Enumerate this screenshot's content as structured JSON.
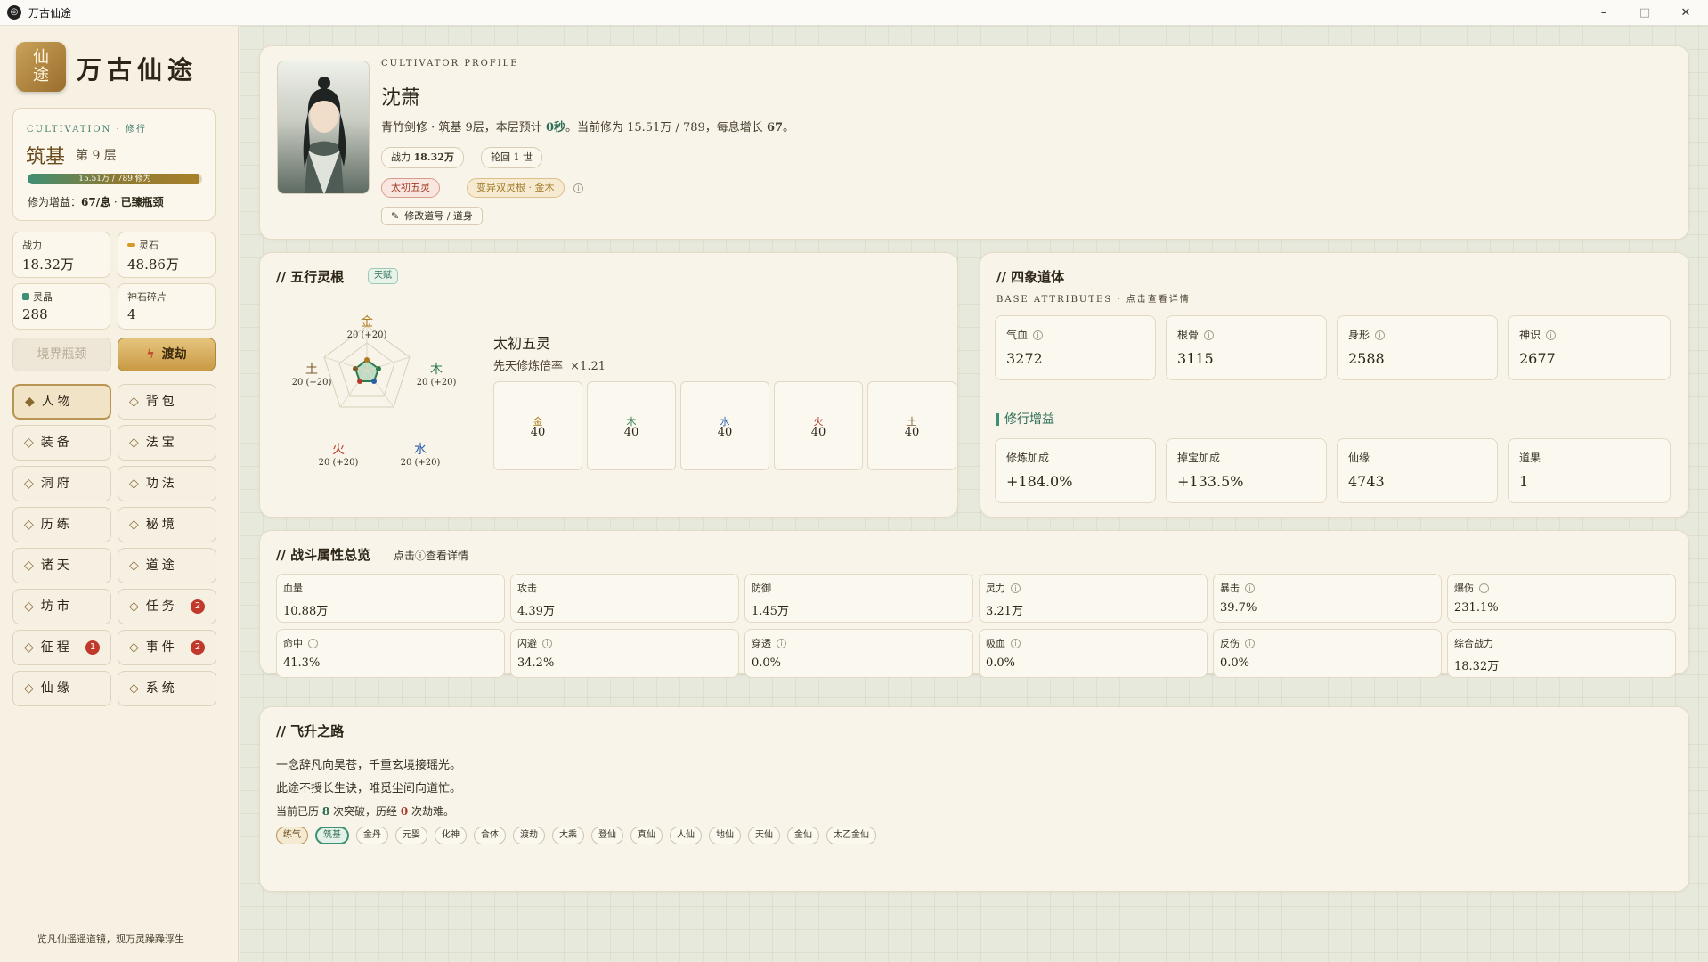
{
  "window": {
    "title": "万古仙途",
    "minimize": "–",
    "maximize": "□",
    "close": "✕"
  },
  "sidebar": {
    "logo": [
      "仙",
      "途"
    ],
    "brand": "万古仙途",
    "cultivation": {
      "label": "CULTIVATION · 修行",
      "realm": "筑基",
      "layer": "第 9 层",
      "progress_text": "15.51万 / 789 修为",
      "progress": 0.98,
      "gain_prefix": "修为增益：",
      "gain_value": "67/息",
      "gain_sep": " · ",
      "gain_status": "已臻瓶颈"
    },
    "stats": [
      {
        "label": "战力",
        "value": "18.32万",
        "icon": ""
      },
      {
        "label": "灵石",
        "value": "48.86万",
        "icon": "spirit-stone-icon"
      },
      {
        "label": "灵晶",
        "value": "288",
        "icon": "crystal-icon"
      },
      {
        "label": "神石碎片",
        "value": "4",
        "icon": ""
      }
    ],
    "btn_bottleneck": "境界瓶颈",
    "btn_tribulation": "渡劫",
    "nav": [
      {
        "label": "人物",
        "active": true,
        "badge": ""
      },
      {
        "label": "背包",
        "active": false,
        "badge": ""
      },
      {
        "label": "装备",
        "active": false,
        "badge": ""
      },
      {
        "label": "法宝",
        "active": false,
        "badge": ""
      },
      {
        "label": "洞府",
        "active": false,
        "badge": ""
      },
      {
        "label": "功法",
        "active": false,
        "badge": ""
      },
      {
        "label": "历练",
        "active": false,
        "badge": ""
      },
      {
        "label": "秘境",
        "active": false,
        "badge": ""
      },
      {
        "label": "诸天",
        "active": false,
        "badge": ""
      },
      {
        "label": "道途",
        "active": false,
        "badge": ""
      },
      {
        "label": "坊市",
        "active": false,
        "badge": ""
      },
      {
        "label": "任务",
        "active": false,
        "badge": "2"
      },
      {
        "label": "征程",
        "active": false,
        "badge": "1"
      },
      {
        "label": "事件",
        "active": false,
        "badge": "2"
      },
      {
        "label": "仙缘",
        "active": false,
        "badge": ""
      },
      {
        "label": "系统",
        "active": false,
        "badge": ""
      }
    ],
    "footer": "览凡仙遥遥道镜，观万灵躁躁浮生"
  },
  "profile": {
    "label": "CULTIVATOR PROFILE",
    "name": "沈萧",
    "desc_pre": "青竹剑修 · 筑基 9层，本层预计 ",
    "desc_time": "0秒",
    "desc_mid": "。当前修为 15.51万 / 789，每息增长 ",
    "desc_rate": "67",
    "desc_end": "。",
    "power_label": "战力",
    "power_value": "18.32万",
    "rebirth_label": "轮回",
    "rebirth_value": "1 世",
    "tag1": "太初五灵",
    "tag2": "变异双灵根 · 金木",
    "edit": "修改道号 / 道身"
  },
  "roots": {
    "title": "// 五行灵根",
    "badge": "天赋",
    "type_name": "太初五灵",
    "rate_label": "先天修炼倍率",
    "rate_value": "×1.21",
    "elements": [
      {
        "name": "金",
        "value": "40",
        "sub": "20 (+20)",
        "color": "#b07a20"
      },
      {
        "name": "木",
        "value": "40",
        "sub": "20 (+20)",
        "color": "#2d7a4a"
      },
      {
        "name": "水",
        "value": "40",
        "sub": "20 (+20)",
        "color": "#2a5ea8"
      },
      {
        "name": "火",
        "value": "40",
        "sub": "20 (+20)",
        "color": "#b43a2a"
      },
      {
        "name": "土",
        "value": "40",
        "sub": "20 (+20)",
        "color": "#7a5a2a"
      }
    ]
  },
  "four": {
    "title": "// 四象道体",
    "subtitle": "BASE ATTRIBUTES · 点击查看详情",
    "attrs": [
      {
        "label": "气血",
        "value": "3272"
      },
      {
        "label": "根骨",
        "value": "3115"
      },
      {
        "label": "身形",
        "value": "2588"
      },
      {
        "label": "神识",
        "value": "2677"
      }
    ],
    "gain_title": "修行增益",
    "gains": [
      {
        "label": "修炼加成",
        "value": "+184.0%"
      },
      {
        "label": "掉宝加成",
        "value": "+133.5%"
      },
      {
        "label": "仙缘",
        "value": "4743"
      },
      {
        "label": "道果",
        "value": "1"
      }
    ]
  },
  "combat": {
    "title": "// 战斗属性总览",
    "hint": "点击ⓘ查看详情",
    "row1": [
      {
        "label": "血量",
        "value": "10.88万",
        "info": false
      },
      {
        "label": "攻击",
        "value": "4.39万",
        "info": false
      },
      {
        "label": "防御",
        "value": "1.45万",
        "info": false
      },
      {
        "label": "灵力",
        "value": "3.21万",
        "info": true
      },
      {
        "label": "暴击",
        "value": "39.7%",
        "info": true
      },
      {
        "label": "爆伤",
        "value": "231.1%",
        "info": true
      }
    ],
    "row2": [
      {
        "label": "命中",
        "value": "41.3%",
        "info": true
      },
      {
        "label": "闪避",
        "value": "34.2%",
        "info": true
      },
      {
        "label": "穿透",
        "value": "0.0%",
        "info": true
      },
      {
        "label": "吸血",
        "value": "0.0%",
        "info": true
      },
      {
        "label": "反伤",
        "value": "0.0%",
        "info": true
      },
      {
        "label": "综合战力",
        "value": "18.32万",
        "info": false
      }
    ]
  },
  "ascend": {
    "title": "// 飞升之路",
    "line1": "一念辞凡向昊苍，千重玄境接瑶光。",
    "line2": "此途不授长生诀，唯觅尘间向道忙。",
    "stat_pre": "当前已历 ",
    "breaks": "8",
    "stat_mid": " 次突破，历经 ",
    "tribs": "0",
    "stat_end": " 次劫难。",
    "realms": [
      "练气",
      "筑基",
      "金丹",
      "元婴",
      "化神",
      "合体",
      "渡劫",
      "大乘",
      "登仙",
      "真仙",
      "人仙",
      "地仙",
      "天仙",
      "金仙",
      "太乙金仙"
    ],
    "done_index": 0,
    "current_index": 1
  },
  "colors": {
    "accent": "#3f8f74",
    "gold": "#b99452",
    "red": "#c0392b",
    "bg": "#f8f4e9"
  }
}
